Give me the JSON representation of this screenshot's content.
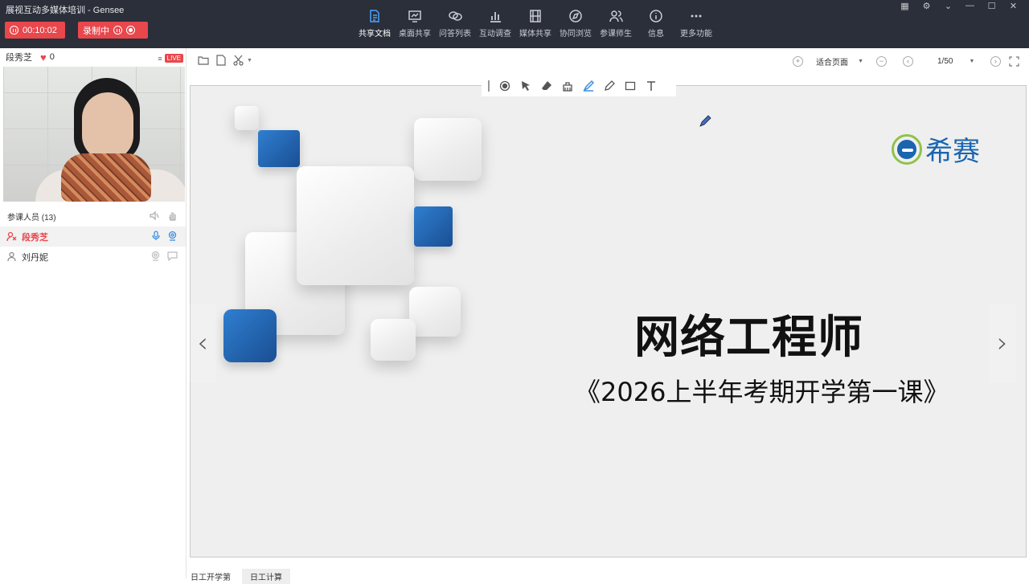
{
  "window": {
    "title": "展视互动多媒体培训 - Gensee"
  },
  "recording": {
    "timer": "00:10:02",
    "status_label": "录制中"
  },
  "nav": [
    {
      "label": "共享文档",
      "icon": "document-icon",
      "active": true
    },
    {
      "label": "桌面共享",
      "icon": "desktop-icon",
      "active": false
    },
    {
      "label": "问答列表",
      "icon": "qa-icon",
      "active": false
    },
    {
      "label": "互动调查",
      "icon": "chart-icon",
      "active": false
    },
    {
      "label": "媒体共享",
      "icon": "film-icon",
      "active": false
    },
    {
      "label": "协同浏览",
      "icon": "compass-icon",
      "active": false
    },
    {
      "label": "参课师生",
      "icon": "users-icon",
      "active": false
    },
    {
      "label": "信息",
      "icon": "info-icon",
      "active": false
    },
    {
      "label": "更多功能",
      "icon": "more-icon",
      "active": false
    }
  ],
  "presenter": {
    "name": "段秀芝",
    "likes": "0",
    "live_badge": "LIVE"
  },
  "participants": {
    "header": "参课人员 (13)",
    "users": [
      {
        "name": "段秀芝",
        "is_self": true
      },
      {
        "name": "刘丹妮",
        "is_self": false
      }
    ]
  },
  "doc_toolbar": {
    "zoom_mode": "适合页面",
    "page": "1/50"
  },
  "slide": {
    "logo_text": "希赛",
    "title": "网络工程师",
    "subtitle": "《2026上半年考期开学第一课》"
  },
  "bottom_tabs": [
    "日工开学第",
    "日工计算"
  ],
  "colors": {
    "topbar": "#2a2f3a",
    "accent_red": "#e8474c",
    "active_blue": "#4aa3ff",
    "slide_blue": "#1a64b0"
  }
}
